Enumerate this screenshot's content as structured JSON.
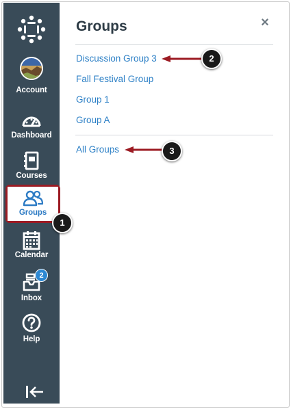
{
  "nav": {
    "items": [
      {
        "key": "account",
        "label": "Account"
      },
      {
        "key": "dashboard",
        "label": "Dashboard"
      },
      {
        "key": "courses",
        "label": "Courses"
      },
      {
        "key": "groups",
        "label": "Groups",
        "active": true
      },
      {
        "key": "calendar",
        "label": "Calendar"
      },
      {
        "key": "inbox",
        "label": "Inbox",
        "badge": "2"
      },
      {
        "key": "help",
        "label": "Help"
      }
    ],
    "colors": {
      "background": "#394b58",
      "active_text": "#2d7bc4",
      "highlight": "#9c1b23"
    }
  },
  "tray": {
    "title": "Groups",
    "close_icon": "close-icon",
    "groups": [
      "Discussion Group 3",
      "Fall Festival Group",
      "Group 1",
      "Group A"
    ],
    "all_groups": "All Groups",
    "link_color": "#2d80c6"
  },
  "callouts": [
    "1",
    "2",
    "3"
  ]
}
